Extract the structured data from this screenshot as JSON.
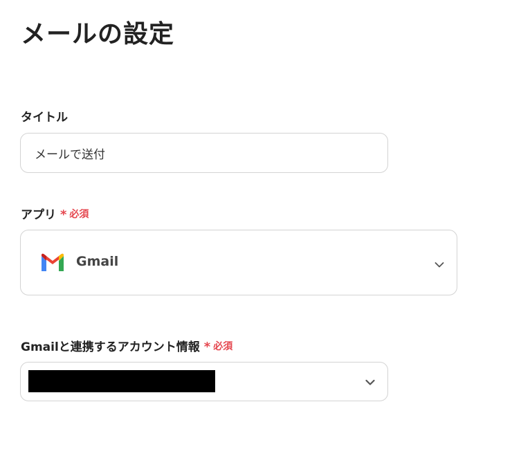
{
  "page": {
    "title": "メールの設定"
  },
  "title_field": {
    "label": "タイトル",
    "value": "メールで送付"
  },
  "app_field": {
    "label": "アプリ",
    "required_mark": "*",
    "required_text": "必須",
    "selected_app": "Gmail",
    "icon": "gmail-icon"
  },
  "account_field": {
    "label": "Gmailと連携するアカウント情報",
    "required_mark": "*",
    "required_text": "必須",
    "selected_value_redacted": true
  },
  "colors": {
    "required": "#e5474f",
    "border": "#d3d3d3",
    "text": "#222222"
  }
}
